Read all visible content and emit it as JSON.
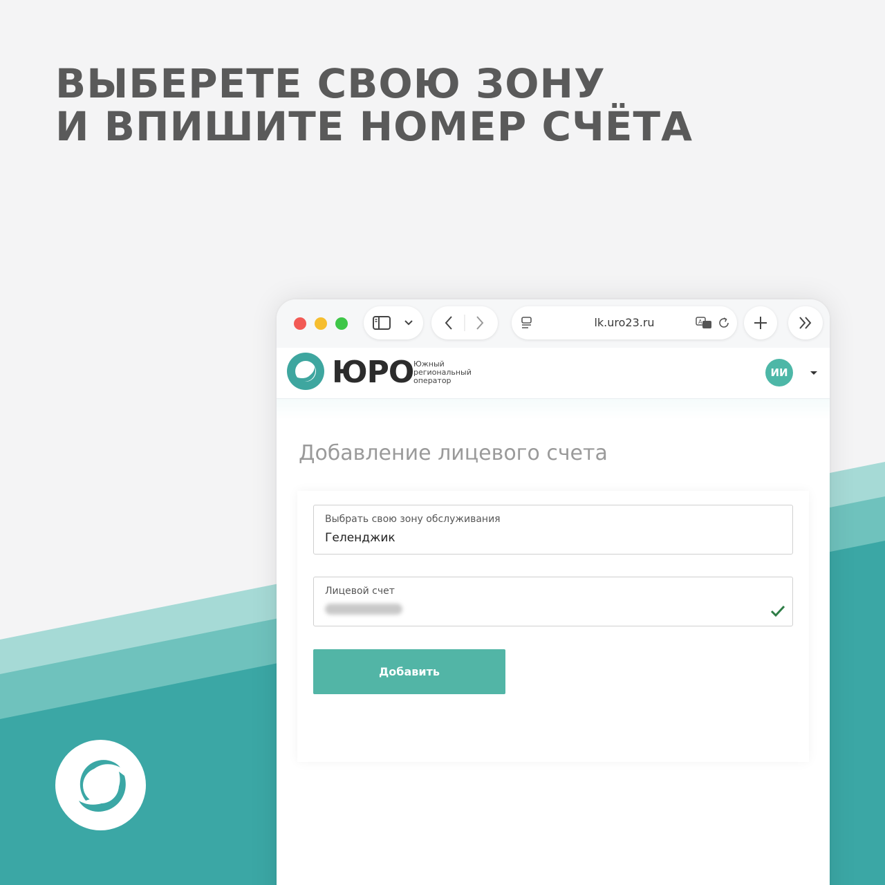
{
  "headline": {
    "line1": "ВЫБЕРЕТЕ СВОЮ ЗОНУ",
    "line2": "И ВПИШИТЕ НОМЕР СЧЁТА"
  },
  "colors": {
    "accent": "#52b5a6",
    "band_dark": "#3ba7a5",
    "band_mid": "#6fc2bd",
    "band_light": "#a6dad6",
    "headline": "#5a5a5a"
  },
  "browser": {
    "url": "lk.uro23.ru",
    "icons": [
      "sidebar-icon",
      "chevron-down-icon",
      "back-icon",
      "forward-icon",
      "tab-overview-icon",
      "translate-icon",
      "reload-icon",
      "new-tab-icon",
      "more-icon"
    ]
  },
  "site": {
    "name": "ЮРО",
    "tagline": [
      "Южный",
      "региональный",
      "оператор"
    ],
    "user_initials": "ИИ"
  },
  "form": {
    "title": "Добавление лицевого счета",
    "zone_label": "Выбрать свою зону обслуживания",
    "zone_value": "Геленджик",
    "account_label": "Лицевой счет",
    "account_value_state": "valid",
    "submit_label": "Добавить"
  }
}
